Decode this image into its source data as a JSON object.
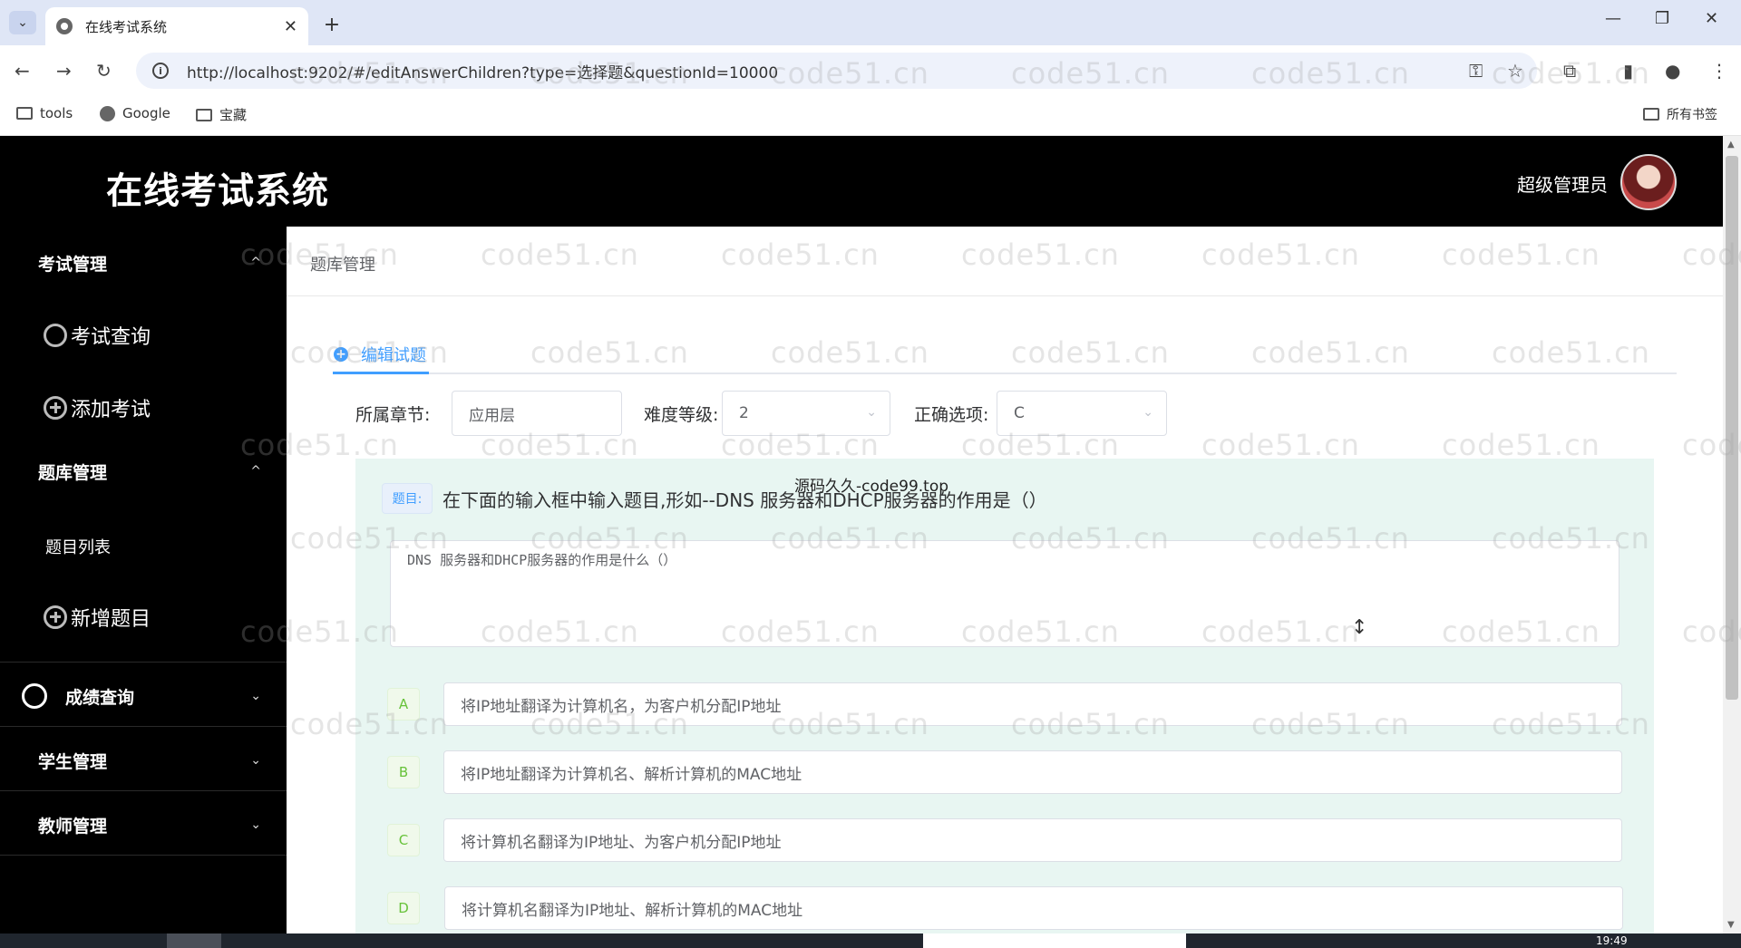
{
  "browser": {
    "tab_title": "在线考试系统",
    "url": "http://localhost:9202/#/editAnswerChildren?type=选择题&questionId=10000",
    "bookmarks": [
      "tools",
      "Google",
      "宝藏"
    ],
    "all_bookmarks": "所有书签"
  },
  "header": {
    "app_title": "在线考试系统",
    "user_name": "超级管理员"
  },
  "sidebar": {
    "groups": [
      {
        "label": "考试管理",
        "items": [
          "考试查询",
          "添加考试"
        ]
      },
      {
        "label": "题库管理",
        "items": [
          "题目列表",
          "新增题目"
        ]
      },
      {
        "label": "成绩查询"
      },
      {
        "label": "学生管理"
      },
      {
        "label": "教师管理"
      }
    ]
  },
  "main": {
    "breadcrumb": "题库管理",
    "tab_label": "编辑试题",
    "form": {
      "chapter_label": "所属章节:",
      "chapter_value": "应用层",
      "difficulty_label": "难度等级:",
      "difficulty_value": "2",
      "correct_label": "正确选项:",
      "correct_value": "C"
    },
    "question": {
      "tag": "题目:",
      "hint": "在下面的输入框中输入题目,形如--DNS 服务器和DHCP服务器的作用是（）",
      "value": "DNS 服务器和DHCP服务器的作用是什么（）"
    },
    "options": [
      {
        "letter": "A",
        "text": "将IP地址翻译为计算机名，为客户机分配IP地址"
      },
      {
        "letter": "B",
        "text": "将IP地址翻译为计算机名、解析计算机的MAC地址"
      },
      {
        "letter": "C",
        "text": "将计算机名翻译为IP地址、为客户机分配IP地址"
      },
      {
        "letter": "D",
        "text": "将计算机名翻译为IP地址、解析计算机的MAC地址"
      }
    ]
  },
  "overlay_text": "源码久久-code99.top",
  "watermark": "code51.cn",
  "taskbar_time": "19:49"
}
